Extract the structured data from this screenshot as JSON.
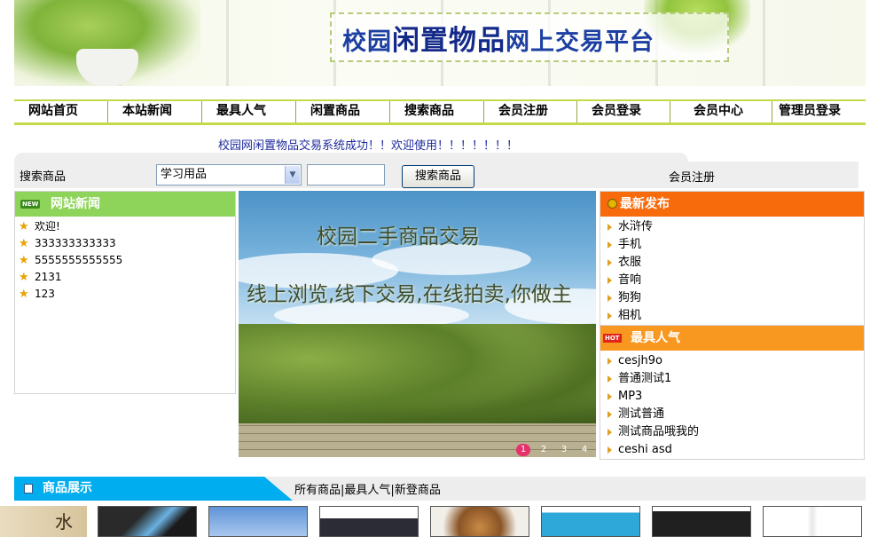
{
  "banner": {
    "title_part1": "校园",
    "title_part2": "闲置物品",
    "title_part3": "网上交易平台"
  },
  "nav": [
    {
      "label": "网站首页",
      "name": "nav-home"
    },
    {
      "label": "本站新闻",
      "name": "nav-news"
    },
    {
      "label": "最具人气",
      "name": "nav-popular"
    },
    {
      "label": "闲置商品",
      "name": "nav-idle-goods"
    },
    {
      "label": "搜索商品",
      "name": "nav-search"
    },
    {
      "label": "会员注册",
      "name": "nav-register"
    },
    {
      "label": "会员登录",
      "name": "nav-login"
    },
    {
      "label": "会员中心",
      "name": "nav-member-center"
    },
    {
      "label": "管理员登录",
      "name": "nav-admin-login"
    }
  ],
  "welcome_text": "校园网闲置物品交易系统成功！！欢迎使用！！！！！！！",
  "search": {
    "label": "搜索商品",
    "category_selected": "学习用品",
    "input_value": "",
    "button_label": "搜索商品",
    "register_label": "会员注册"
  },
  "news_panel": {
    "tag": "NEW",
    "title": "网站新闻",
    "items": [
      "欢迎!",
      "333333333333",
      "5555555555555",
      "2131",
      "123"
    ]
  },
  "slideshow": {
    "title": "校园二手商品交易",
    "subtitle": "线上浏览,线下交易,在线拍卖,你做主",
    "pages": [
      "1",
      "2",
      "3",
      "4"
    ],
    "active_page": "1"
  },
  "latest_panel": {
    "title": "最新发布",
    "items": [
      "水浒传",
      "手机",
      "衣服",
      "音响",
      "狗狗",
      "相机"
    ]
  },
  "popular_panel": {
    "tag": "HOT",
    "title": "最具人气",
    "items": [
      "cesjh9o",
      "普通测试1",
      "MP3",
      "测试普通",
      "测试商品哦我的",
      "ceshi asd"
    ]
  },
  "products": {
    "title": "商品展示",
    "links": [
      "所有商品",
      "最具人气",
      "新登商品"
    ],
    "separator": "|"
  },
  "colors": {
    "nav_border": "#c5d94a",
    "news_header": "#8fd45a",
    "latest_header": "#f76b0d",
    "popular_header": "#f89820",
    "products_header": "#00aeef",
    "welcome_text": "#1e2a9c",
    "slide_active_dot": "#e6316b"
  }
}
